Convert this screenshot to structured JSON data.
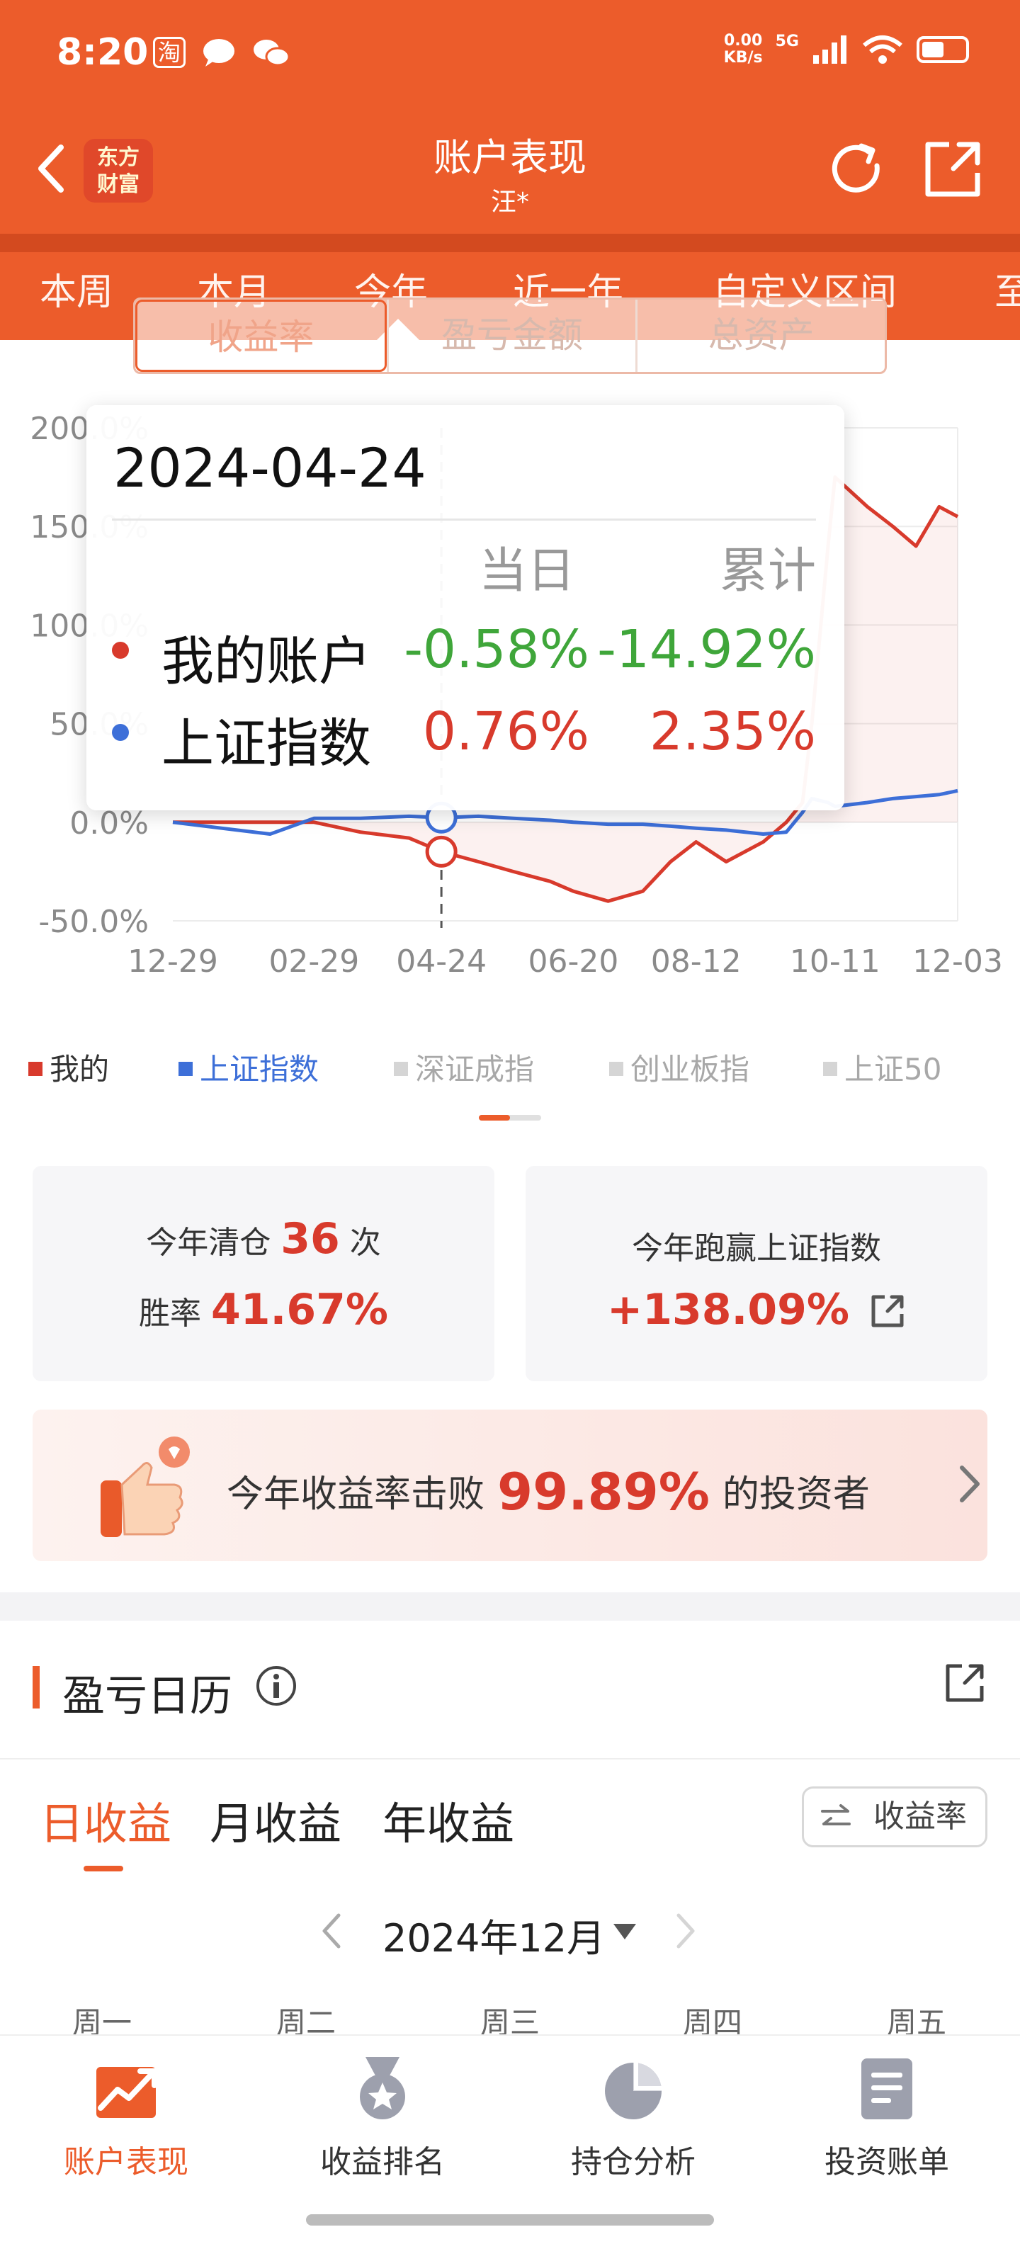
{
  "status": {
    "time": "8:20",
    "net_speed_value": "0.00",
    "net_speed_unit": "KB/s",
    "net_type": "5G"
  },
  "header": {
    "title": "账户表现",
    "subtitle": "汪*",
    "brand_line1": "东方",
    "brand_line2": "财富",
    "accent_color": "#ec5c2b"
  },
  "period_tabs": [
    "本周",
    "本月",
    "今年",
    "近一年",
    "自定义区间",
    "至"
  ],
  "active_period": "今年",
  "metric_toggle": [
    "收益率",
    "盈亏金额",
    "总资产"
  ],
  "chart_data": {
    "type": "line",
    "y_ticks": [
      "200.0%",
      "150.0%",
      "100.0%",
      "50.0%",
      "0.0%",
      "-50.0%"
    ],
    "ylim": [
      -50,
      200
    ],
    "x_ticks": [
      "12-29",
      "02-29",
      "04-24",
      "06-20",
      "08-12",
      "10-11",
      "12-03"
    ],
    "series": [
      {
        "name": "我的",
        "color": "#d83a2c",
        "x": [
          "12-29",
          "01-20",
          "02-10",
          "02-29",
          "03-20",
          "04-10",
          "04-24",
          "05-10",
          "05-25",
          "06-10",
          "06-20",
          "07-05",
          "07-20",
          "08-01",
          "08-12",
          "08-25",
          "09-10",
          "09-20",
          "09-27",
          "10-01",
          "10-08",
          "10-11",
          "10-25",
          "11-05",
          "11-15",
          "11-25",
          "12-03"
        ],
        "values": [
          0,
          0,
          0,
          0,
          -5,
          -8,
          -14.92,
          -20,
          -25,
          -30,
          -35,
          -40,
          -35,
          -20,
          -10,
          -20,
          -10,
          0,
          10,
          50,
          140,
          175,
          160,
          150,
          140,
          160,
          155
        ]
      },
      {
        "name": "上证指数",
        "color": "#3d6fd8",
        "x": [
          "12-29",
          "01-20",
          "02-10",
          "02-29",
          "03-20",
          "04-10",
          "04-24",
          "05-10",
          "05-25",
          "06-10",
          "06-20",
          "07-05",
          "07-20",
          "08-01",
          "08-12",
          "08-25",
          "09-10",
          "09-20",
          "09-27",
          "10-01",
          "10-08",
          "10-11",
          "10-25",
          "11-05",
          "11-15",
          "11-25",
          "12-03"
        ],
        "values": [
          0,
          -3,
          -6,
          2,
          2,
          3,
          2.35,
          3,
          2,
          1,
          0,
          -1,
          -1,
          -2,
          -3,
          -4,
          -6,
          -5,
          5,
          12,
          10,
          8,
          10,
          12,
          13,
          14,
          16
        ]
      }
    ],
    "tooltip": {
      "date": "2024-04-24",
      "head_day": "当日",
      "head_cum": "累计",
      "rows": [
        {
          "name": "我的账户",
          "day": "-0.58%",
          "cum": "-14.92%",
          "color": "#d83a2c",
          "day_color": "#3fa63a",
          "cum_color": "#3fa63a"
        },
        {
          "name": "上证指数",
          "day": "0.76%",
          "cum": "2.35%",
          "color": "#3d6fd8",
          "day_color": "#d83a2c",
          "cum_color": "#d83a2c"
        }
      ]
    }
  },
  "legend": [
    {
      "label": "我的",
      "color": "#d83a2c",
      "text_color": "#333333"
    },
    {
      "label": "上证指数",
      "color": "#3d6fd8",
      "text_color": "#3d6fd8"
    },
    {
      "label": "深证成指",
      "color": "#d5d5d5",
      "text_color": "#a8a8a8"
    },
    {
      "label": "创业板指",
      "color": "#d5d5d5",
      "text_color": "#a8a8a8"
    },
    {
      "label": "上证50",
      "color": "#d5d5d5",
      "text_color": "#a8a8a8"
    }
  ],
  "stats": {
    "clear_prefix": "今年清仓",
    "clear_count": "36",
    "clear_suffix": "次",
    "winrate_label": "胜率",
    "winrate_value": "41.67%",
    "beat_index_label": "今年跑赢上证指数",
    "beat_index_value": "+138.09%"
  },
  "beat_investors": {
    "prefix": "今年收益率击败",
    "value": "99.89%",
    "suffix": "的投资者"
  },
  "calendar": {
    "title": "盈亏日历",
    "tabs": [
      "日收益",
      "月收益",
      "年收益"
    ],
    "rate_toggle": "收益率",
    "month": "2024年12月",
    "weekdays": [
      "周一",
      "周二",
      "周三",
      "周四",
      "周五"
    ]
  },
  "bottom_nav": [
    {
      "label": "账户表现",
      "icon": "trend-chart-icon"
    },
    {
      "label": "收益排名",
      "icon": "medal-icon"
    },
    {
      "label": "持仓分析",
      "icon": "pie-chart-icon"
    },
    {
      "label": "投资账单",
      "icon": "bill-icon"
    }
  ]
}
